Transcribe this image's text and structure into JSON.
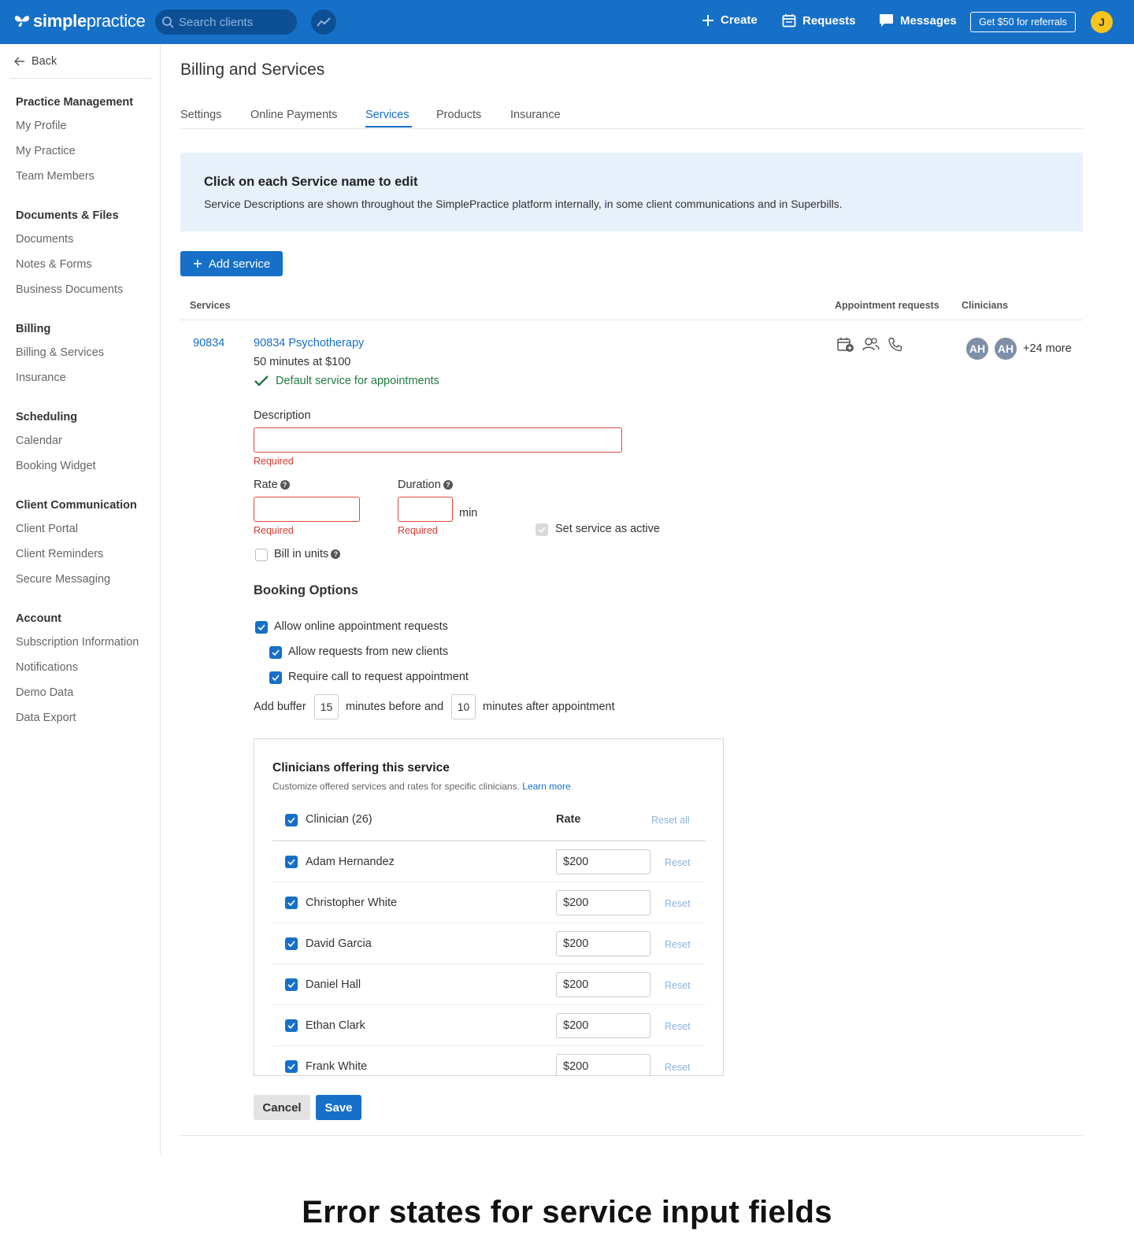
{
  "topbar": {
    "logo_prefix": "simple",
    "logo_suffix": "practice",
    "search_placeholder": "Search clients",
    "create": "Create",
    "requests": "Requests",
    "messages": "Messages",
    "referral": "Get $50 for referrals",
    "avatar_initial": "J",
    "brand_color": "#1670c7"
  },
  "sidebar": {
    "back": "Back",
    "groups": [
      {
        "title": "Practice Management",
        "items": [
          "My Profile",
          "My Practice",
          "Team Members"
        ]
      },
      {
        "title": "Documents & Files",
        "items": [
          "Documents",
          "Notes & Forms",
          "Business Documents"
        ]
      },
      {
        "title": "Billing",
        "items": [
          "Billing & Services",
          "Insurance"
        ]
      },
      {
        "title": "Scheduling",
        "items": [
          "Calendar",
          "Booking Widget"
        ]
      },
      {
        "title": "Client Communication",
        "items": [
          "Client Portal",
          "Client Reminders",
          "Secure Messaging"
        ]
      },
      {
        "title": "Account",
        "items": [
          "Subscription Information",
          "Notifications",
          "Demo Data",
          "Data Export"
        ]
      }
    ]
  },
  "main": {
    "title": "Billing and Services",
    "tabs": [
      "Settings",
      "Online Payments",
      "Services",
      "Products",
      "Insurance"
    ],
    "active_tab": "Services",
    "banner": {
      "title": "Click on each Service name to edit",
      "text": "Service Descriptions are shown throughout the SimplePractice platform internally, in some client communications and in Superbills."
    },
    "add_service": "Add service",
    "columns": {
      "services": "Services",
      "appointment_requests": "Appointment requests",
      "clinicians": "Clinicians"
    },
    "service": {
      "code": "90834",
      "name": "90834 Psychotherapy",
      "summary": "50 minutes at $100",
      "default": "Default service for appointments",
      "clinician_avatars": [
        "AH",
        "AH"
      ],
      "more": "+24 more"
    },
    "form": {
      "description_label": "Description",
      "description_value": "",
      "required": "Required",
      "rate_label": "Rate",
      "rate_value": "",
      "duration_label": "Duration",
      "duration_value": "",
      "min": "min",
      "active_label": "Set service as active",
      "bill_units_label": "Bill in units"
    },
    "booking": {
      "title": "Booking Options",
      "allow_online": "Allow online appointment requests",
      "allow_new": "Allow requests from new clients",
      "require_call": "Require call to request appointment",
      "buffer_prefix": "Add buffer",
      "buffer_before": "15",
      "buffer_mid": "minutes before and",
      "buffer_after": "10",
      "buffer_suffix": "minutes after appointment"
    },
    "clinicians_box": {
      "title": "Clinicians offering this service",
      "subtitle": "Customize offered services and rates for specific clinicians.",
      "learn_more": "Learn more",
      "header_name": "Clinician (26)",
      "header_rate": "Rate",
      "reset_all": "Reset all",
      "reset": "Reset",
      "rows": [
        {
          "name": "Adam Hernandez",
          "rate": "$200"
        },
        {
          "name": "Christopher White",
          "rate": "$200"
        },
        {
          "name": "David Garcia",
          "rate": "$200"
        },
        {
          "name": "Daniel Hall",
          "rate": "$200"
        },
        {
          "name": "Ethan Clark",
          "rate": "$200"
        },
        {
          "name": "Frank White",
          "rate": "$200"
        }
      ]
    },
    "cancel": "Cancel",
    "save": "Save"
  },
  "caption": "Error states for service input fields"
}
